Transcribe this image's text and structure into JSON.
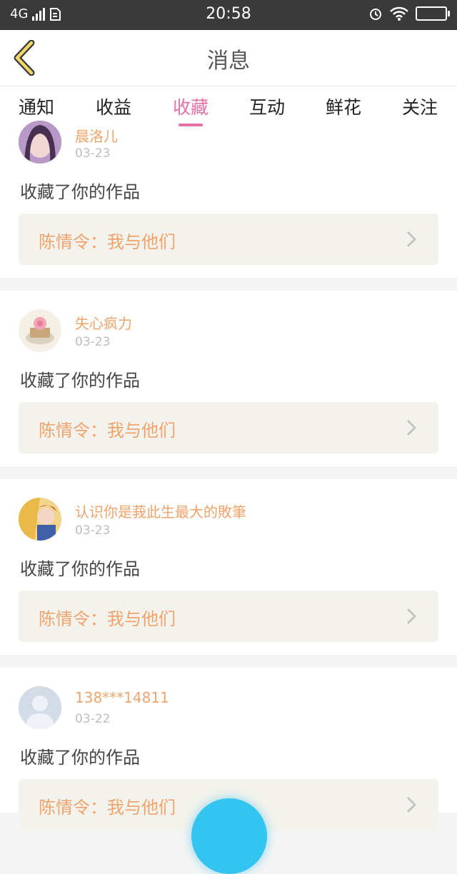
{
  "status_bar": {
    "network": "4G",
    "time": "20:58"
  },
  "header": {
    "title": "消息"
  },
  "tabs": [
    {
      "label": "通知"
    },
    {
      "label": "收益"
    },
    {
      "label": "收藏"
    },
    {
      "label": "互动"
    },
    {
      "label": "鲜花"
    },
    {
      "label": "关注"
    }
  ],
  "active_tab": "收藏",
  "messages": [
    {
      "username": "晨洛儿",
      "date": "03-23",
      "action": "收藏了你的作品",
      "work_title": "陈情令：我与他们"
    },
    {
      "username": "失心疯力",
      "date": "03-23",
      "action": "收藏了你的作品",
      "work_title": "陈情令：我与他们"
    },
    {
      "username": "认识你是莪此生最大的敗筆",
      "date": "03-23",
      "action": "收藏了你的作品",
      "work_title": "陈情令：我与他们"
    },
    {
      "username": "138***14811",
      "date": "03-22",
      "action": "收藏了你的作品",
      "work_title": "陈情令：我与他们"
    }
  ],
  "colors": {
    "accent": "#e66fa4",
    "username": "#f0a36b",
    "fab": "#33c4f0",
    "back_icon": "#f0d76a"
  }
}
